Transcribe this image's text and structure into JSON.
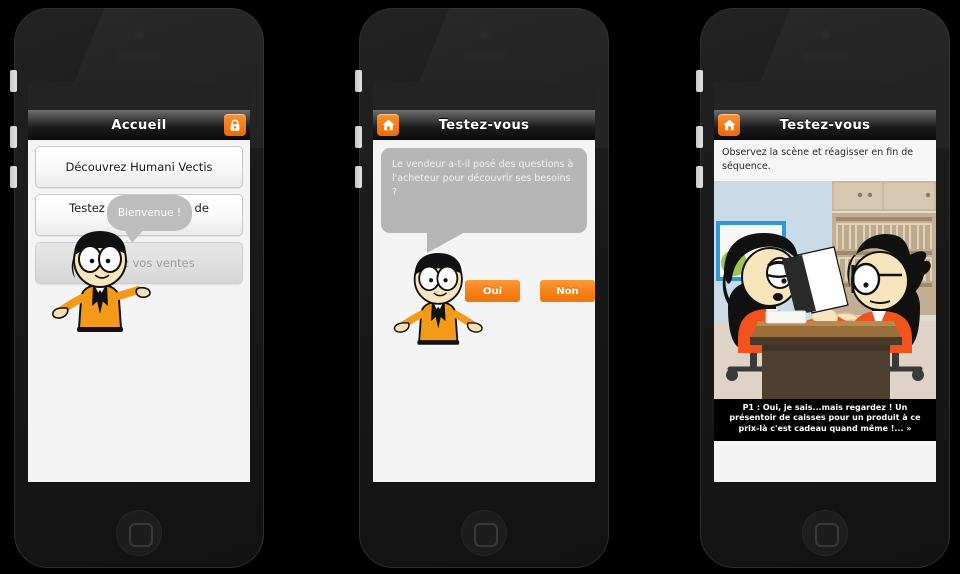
{
  "app": {
    "accent_orange": "#f3810f",
    "phones": [
      {
        "id": "home",
        "navbar": {
          "title": "Accueil",
          "right_icon": "lock-icon"
        },
        "menu_items": [
          {
            "label": "Découvrez Humani Vectis",
            "disabled": false
          },
          {
            "label": "Testez votre capacité de vendeur",
            "disabled": false
          },
          {
            "label": "Boostez vos ventes",
            "disabled": true
          }
        ],
        "character_bubble": "Bienvenue !"
      },
      {
        "id": "quiz",
        "navbar": {
          "title": "Testez-vous",
          "left_icon": "home-icon"
        },
        "question": "Le vendeur a-t-il posé des questions à l'acheteur pour découvrir ses besoins ?",
        "answers": [
          {
            "label": "Oui"
          },
          {
            "label": "Non"
          }
        ]
      },
      {
        "id": "scene",
        "navbar": {
          "title": "Testez-vous",
          "left_icon": "home-icon"
        },
        "instruction": "Observez la scène et réagisser en fin de séquence.",
        "caption": "P1 : Oui, je sais...mais regardez !  Un présentoir de caisses pour un produit à ce prix-là c'est cadeau quand même !... »"
      }
    ]
  }
}
